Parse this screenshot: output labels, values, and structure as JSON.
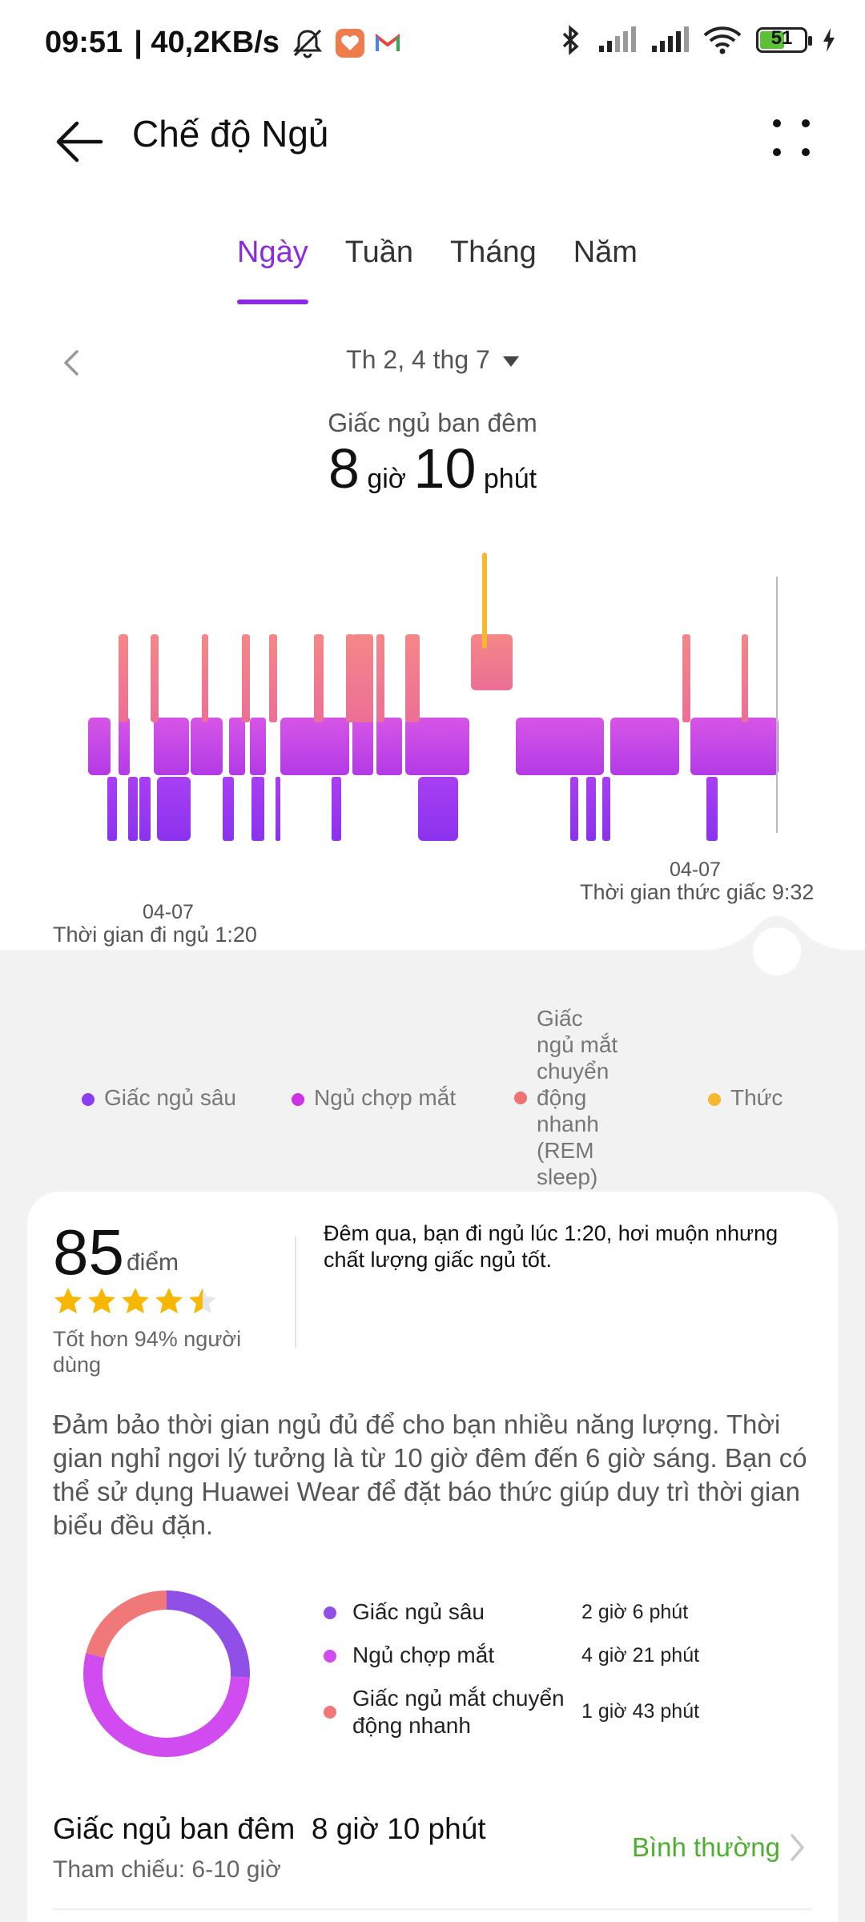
{
  "status_bar": {
    "time": "09:51",
    "speed": "| 40,2KB/s",
    "battery": "51"
  },
  "header": {
    "title": "Chế độ Ngủ"
  },
  "tabs": [
    {
      "label": "Ngày",
      "active": true
    },
    {
      "label": "Tuần",
      "active": false
    },
    {
      "label": "Tháng",
      "active": false
    },
    {
      "label": "Năm",
      "active": false
    }
  ],
  "date": "Th 2, 4 thg 7",
  "night_sleep": {
    "label": "Giấc ngủ ban đêm",
    "hours": "8",
    "hours_unit": "giờ",
    "minutes": "10",
    "minutes_unit": "phút"
  },
  "chart_axis": {
    "start_date": "04-07",
    "start_label": "Thời gian đi ngủ 1:20",
    "end_date": "04-07",
    "end_label": "Thời gian thức giấc 9:32"
  },
  "legend": [
    {
      "label": "Giấc ngủ sâu",
      "color": "#8a3ff0"
    },
    {
      "label": "Ngủ chợp mắt",
      "color": "#cc33e6"
    },
    {
      "label": "Giấc ngủ mắt chuyển động nhanh (REM sleep)",
      "color": "#f07373"
    },
    {
      "label": "Thức",
      "color": "#f5b82e"
    }
  ],
  "score_card": {
    "score": "85",
    "score_unit": "điểm",
    "rating_stars": 4.5,
    "better_than": "Tốt hơn 94% người dùng",
    "summary": "Đêm qua, bạn đi ngủ lúc 1:20, hơi muộn nhưng chất lượng giấc ngủ tốt.",
    "advice": "Đảm bảo thời gian ngủ đủ để cho bạn nhiều năng lượng. Thời gian nghỉ ngơi lý tưởng là từ 10 giờ đêm đến 6 giờ sáng. Bạn có thể sử dụng Huawei Wear để đặt báo thức giúp duy trì thời gian biểu đều đặn."
  },
  "breakdown": [
    {
      "label": "Giấc ngủ sâu",
      "value": "2 giờ 6 phút",
      "minutes": 126,
      "color": "#9050e8"
    },
    {
      "label": "Ngủ chợp mắt",
      "value": "4 giờ 21 phút",
      "minutes": 261,
      "color": "#d04cf0"
    },
    {
      "label": "Giấc ngủ mắt chuyển động nhanh",
      "value": "1 giờ 43 phút",
      "minutes": 103,
      "color": "#f07878"
    }
  ],
  "night_total": {
    "label": "Giấc ngủ ban đêm",
    "value": "8 giờ 10 phút",
    "reference": "Tham chiếu: 6-10 giờ",
    "status": "Bình thường",
    "status_color": "#4caf2f"
  }
}
